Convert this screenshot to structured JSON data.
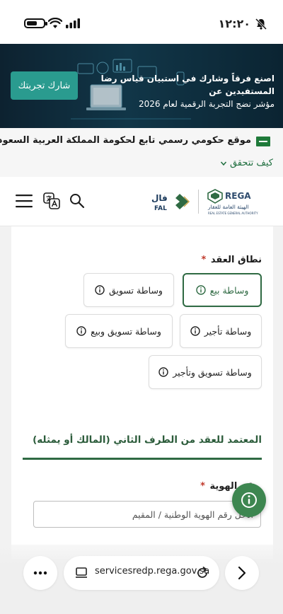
{
  "status_bar": {
    "time": "١٢:٢٠"
  },
  "banner": {
    "line1": "اصنع فرقاً وشارك في استبيان قياس رضا المستفيدين عن",
    "line2": "مؤشر نضج التجربة الرقمية لعام 2026",
    "button_label": "شارك تجربتك"
  },
  "gov_strip": {
    "text": "موقع حكومي رسمي تابع لحكومة المملكة العربية السعودية",
    "verify_label": "كيف تتحقق"
  },
  "header": {
    "fal_logo_text": "فال",
    "fal_logo_sub": "FAL",
    "rega_logo_text": "REGA",
    "rega_logo_ar": "الهيئة العامة للعقار",
    "rega_logo_en": "REAL ESTATE GENERAL AUTHORITY"
  },
  "form": {
    "scope_label": "نطاق العقد",
    "required_mark": "*",
    "options": [
      {
        "label": "وساطة بيع",
        "selected": true
      },
      {
        "label": "وساطة تسويق",
        "selected": false
      },
      {
        "label": "وساطة تأجير",
        "selected": false
      },
      {
        "label": "وساطة تسويق وبيع",
        "selected": false
      },
      {
        "label": "وساطة تسويق وتأجير",
        "selected": false
      }
    ],
    "section_title": "المعتمد للعقد من الطرف الثاني (المالك أو يمثله)",
    "id_label": "رقم الهوية",
    "id_placeholder": "أدخل رقم الهوية الوطنية / المقيم",
    "id_value": ""
  },
  "browser": {
    "url": "servicesredp.rega.gov.sa"
  },
  "colors": {
    "brand_green": "#2f6a43",
    "banner_button": "#2a9b8f",
    "fab_green": "#3d8650"
  }
}
